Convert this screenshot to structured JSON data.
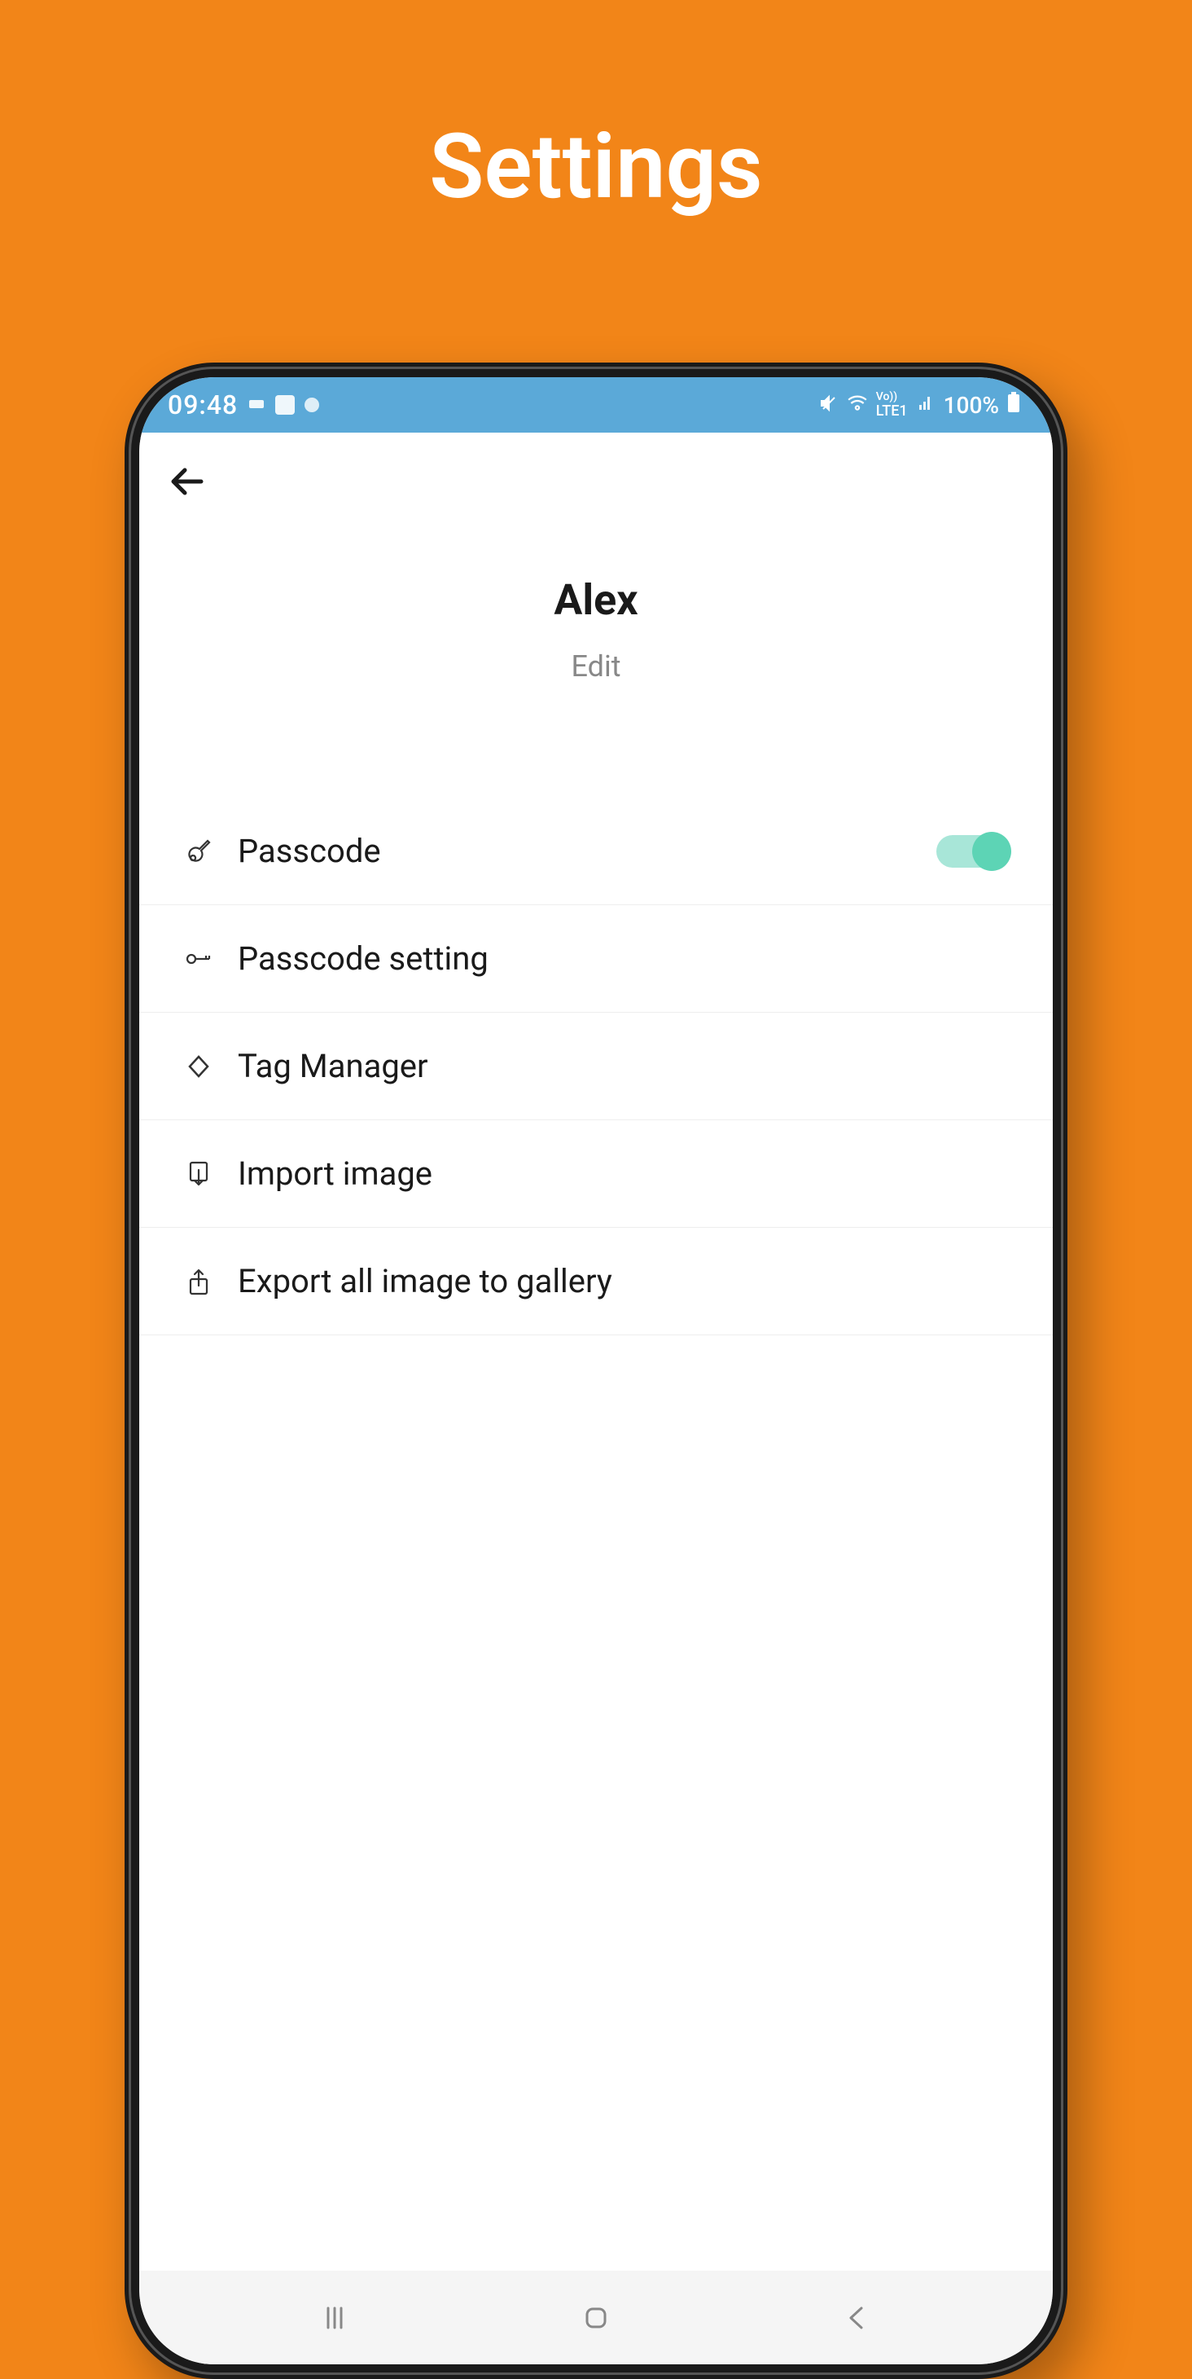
{
  "page": {
    "title": "Settings"
  },
  "statusBar": {
    "time": "09:48",
    "battery": "100%",
    "network": "LTE1"
  },
  "profile": {
    "name": "Alex",
    "editLabel": "Edit"
  },
  "settings": {
    "items": [
      {
        "label": "Passcode",
        "icon": "guitar",
        "hasToggle": true,
        "toggleOn": true
      },
      {
        "label": "Passcode setting",
        "icon": "key"
      },
      {
        "label": "Tag Manager",
        "icon": "diamond"
      },
      {
        "label": "Import image",
        "icon": "import"
      },
      {
        "label": "Export all image to gallery",
        "icon": "export"
      }
    ]
  }
}
